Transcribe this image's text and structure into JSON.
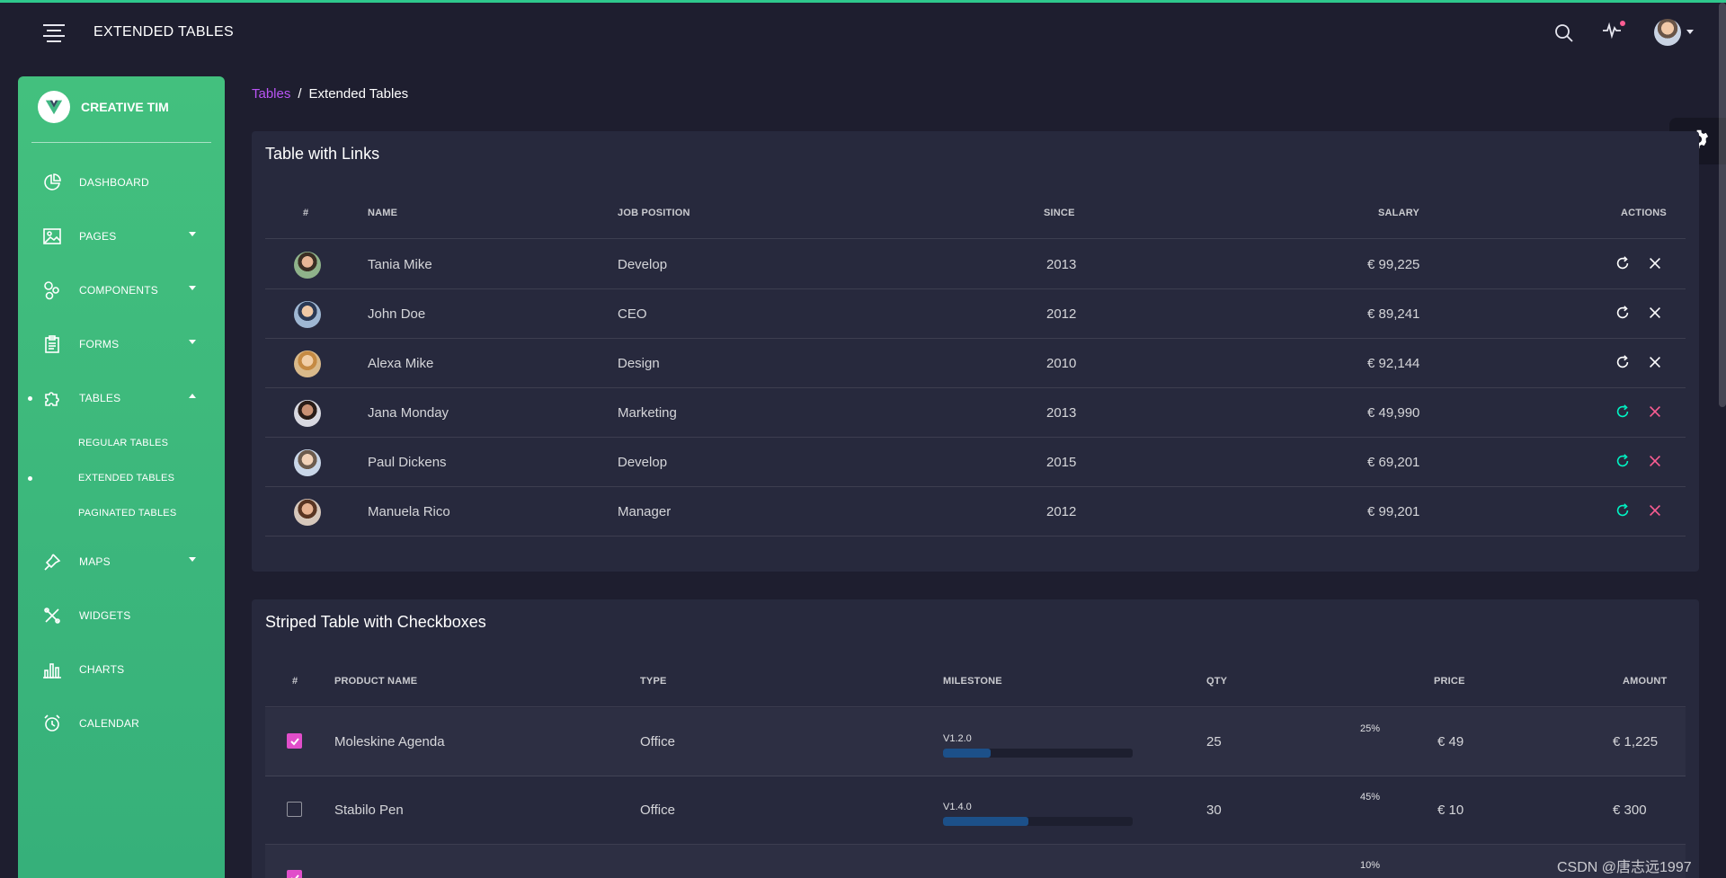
{
  "navbar": {
    "title": "EXTENDED TABLES",
    "menu_icon": "menu-lines-icon",
    "search_icon": "search-icon",
    "activity_icon": "activity-icon",
    "avatar": "user-avatar"
  },
  "sidebar": {
    "brand": "CREATIVE TIM",
    "items": [
      {
        "label": "DASHBOARD",
        "icon": "chart-pie-icon"
      },
      {
        "label": "PAGES",
        "icon": "image-icon"
      },
      {
        "label": "COMPONENTS",
        "icon": "molecule-icon"
      },
      {
        "label": "FORMS",
        "icon": "clipboard-icon"
      },
      {
        "label": "TABLES",
        "icon": "puzzle-icon"
      },
      {
        "label": "MAPS",
        "icon": "pin-icon"
      },
      {
        "label": "WIDGETS",
        "icon": "settings-tool-icon"
      },
      {
        "label": "CHARTS",
        "icon": "bar-chart-icon"
      },
      {
        "label": "CALENDAR",
        "icon": "alarm-clock-icon"
      }
    ],
    "subitems": [
      {
        "label": "REGULAR TABLES"
      },
      {
        "label": "EXTENDED TABLES"
      },
      {
        "label": "PAGINATED TABLES"
      }
    ]
  },
  "breadcrumb": {
    "parent": "Tables",
    "separator": "/",
    "current": "Extended Tables"
  },
  "table_links": {
    "title": "Table with Links",
    "headers": [
      "#",
      "NAME",
      "JOB POSITION",
      "SINCE",
      "SALARY",
      "ACTIONS"
    ],
    "rows": [
      {
        "name": "Tania Mike",
        "position": "Develop",
        "since": "2013",
        "salary": "€ 99,225"
      },
      {
        "name": "John Doe",
        "position": "CEO",
        "since": "2012",
        "salary": "€ 89,241"
      },
      {
        "name": "Alexa Mike",
        "position": "Design",
        "since": "2010",
        "salary": "€ 92,144"
      },
      {
        "name": "Jana Monday",
        "position": "Marketing",
        "since": "2013",
        "salary": "€ 49,990"
      },
      {
        "name": "Paul Dickens",
        "position": "Develop",
        "since": "2015",
        "salary": "€ 69,201"
      },
      {
        "name": "Manuela Rico",
        "position": "Manager",
        "since": "2012",
        "salary": "€ 99,201"
      }
    ]
  },
  "table_striped": {
    "title": "Striped Table with Checkboxes",
    "headers": [
      "#",
      "PRODUCT NAME",
      "TYPE",
      "MILESTONE",
      "QTY",
      "PRICE",
      "AMOUNT"
    ],
    "rows": [
      {
        "checked": true,
        "product": "Moleskine Agenda",
        "type": "Office",
        "milestone": "V1.2.0",
        "progress": "25%",
        "progress_value": 25,
        "qty": "25",
        "price": "€ 49",
        "amount": "€ 1,225"
      },
      {
        "checked": false,
        "product": "Stabilo Pen",
        "type": "Office",
        "milestone": "V1.4.0",
        "progress": "45%",
        "progress_value": 45,
        "qty": "30",
        "price": "€ 10",
        "amount": "€ 300"
      },
      {
        "checked": true,
        "product": "",
        "type": "",
        "milestone": "",
        "progress": "10%",
        "progress_value": 10,
        "qty": "",
        "price": "",
        "amount": ""
      }
    ]
  },
  "watermark": "CSDN @唐志远1997",
  "colors": {
    "background": "#1e1e2f",
    "card": "#27293d",
    "sidebar_green": "#43c07e",
    "accent_purple": "#ba54f5",
    "checkbox_pink": "#e14eca",
    "action_green": "#00f2c3",
    "action_red": "#fd5d93"
  }
}
